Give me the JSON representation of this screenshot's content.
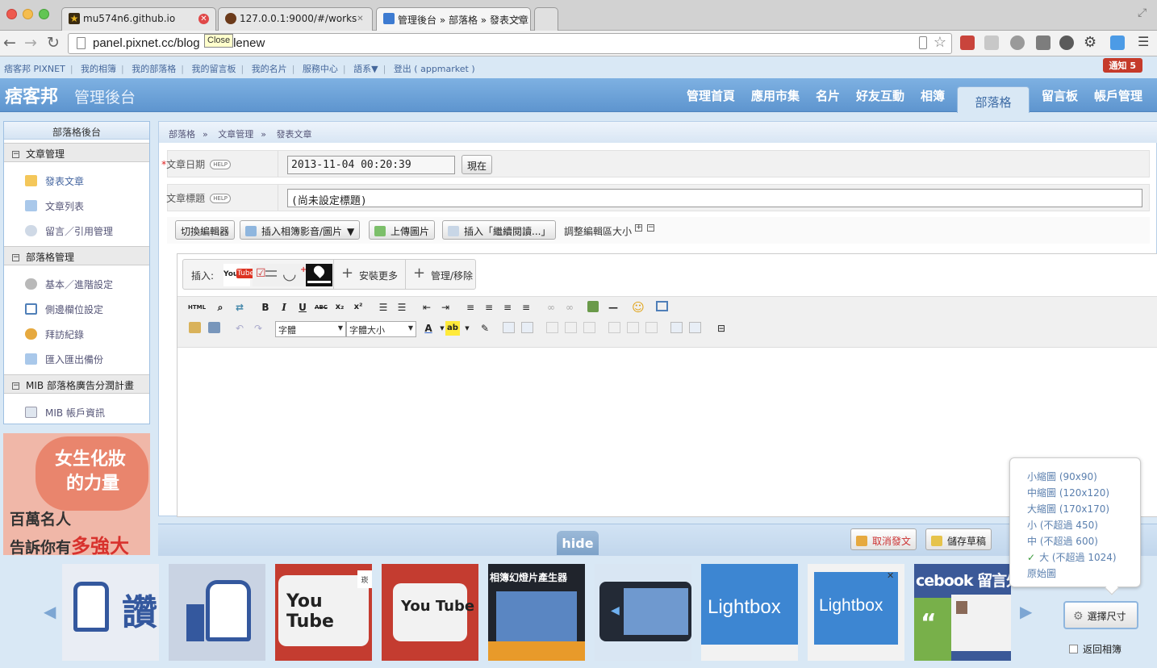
{
  "browser": {
    "tabs": [
      {
        "title": "mu574n6.github.io"
      },
      {
        "title": "127.0.0.1:9000/#/works"
      },
      {
        "title": "管理後台 » 部落格 » 發表文章"
      }
    ],
    "url_prefix": "panel.pixnet.cc/blog",
    "url_suffix": "clenew",
    "tooltip": "Close"
  },
  "topbar": {
    "links": [
      "痞客邦 PIXNET",
      "我的相簿",
      "我的部落格",
      "我的留言板",
      "我的名片",
      "服務中心",
      "語系▼",
      "登出 ( appmarket )"
    ],
    "notice": "通知 5"
  },
  "header": {
    "logo": "痞客邦",
    "subtitle": "管理後台",
    "nav": [
      "管理首頁",
      "應用市集",
      "名片",
      "好友互動",
      "相簿",
      "部落格",
      "留言板",
      "帳戶管理"
    ],
    "active_nav": "部落格"
  },
  "sidebar": {
    "title": "部落格後台",
    "groups": [
      {
        "label": "文章管理",
        "items": [
          "發表文章",
          "文章列表",
          "留言／引用管理"
        ]
      },
      {
        "label": "部落格管理",
        "items": [
          "基本／進階設定",
          "側邊欄位設定",
          "拜訪紀錄",
          "匯入匯出備份"
        ]
      },
      {
        "label": "MIB 部落格廣告分潤計畫",
        "items": [
          "MIB 帳戶資訊"
        ]
      }
    ],
    "ad": {
      "line1": "女生化妝",
      "line2": "的力量",
      "line3": "百萬名人",
      "line4a": "告訴你有",
      "line4b": "多強大"
    }
  },
  "breadcrumb": [
    "部落格",
    "文章管理",
    "發表文章"
  ],
  "form": {
    "date_required": "*",
    "date_label": "文章日期",
    "date_value": "2013-11-04 00:20:39",
    "now_button": "現在",
    "title_label": "文章標題",
    "title_value": "(尚未設定標題)",
    "help": "HELP"
  },
  "editor_toolbar": {
    "switch_editor": "切換編輯器",
    "insert_album": "插入相簿影音/圖片",
    "upload_image": "上傳圖片",
    "insert_more": "插入「繼續閱讀...」",
    "resize_label": "調整編輯區大小"
  },
  "inserts": {
    "label": "插入:",
    "install_more": "安裝更多",
    "manage": "管理/移除"
  },
  "format": {
    "html": "HTML",
    "font": "字體",
    "font_size": "字體大小"
  },
  "bottom": {
    "hide": "hide",
    "cancel": "取消發文",
    "save_draft": "儲存草稿"
  },
  "thumbs": [
    "讚",
    "",
    "You Tube",
    "You Tube",
    "相簿幻燈片產生器",
    "",
    "Lightbox",
    "Lightbox",
    "cebook 留言外"
  ],
  "size_popup": {
    "options": [
      "小縮圖 (90x90)",
      "中縮圖 (120x120)",
      "大縮圖 (170x170)",
      "小 (不超過 450)",
      "中 (不超過 600)",
      "大 (不超過 1024)",
      "原始圖"
    ],
    "selected": "大 (不超過 1024)",
    "check": "✓",
    "select_button": "選擇尺寸",
    "back_album": "返回相簿"
  }
}
